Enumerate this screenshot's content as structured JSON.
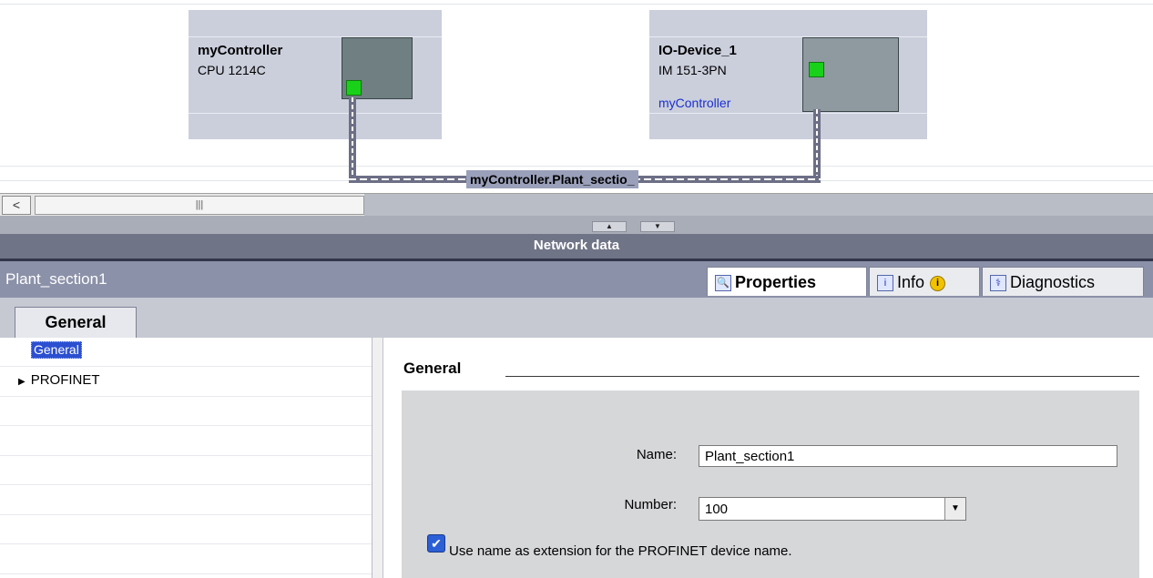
{
  "canvas": {
    "devices": [
      {
        "name": "myController",
        "type": "CPU 1214C",
        "assigned_to": ""
      },
      {
        "name": "IO-Device_1",
        "type": "IM 151-3PN",
        "assigned_to": "myController"
      }
    ],
    "subnet_label": "myController.Plant_sectio_"
  },
  "scrollbar": {
    "left_arrow": "<",
    "thumb_grip": "|||"
  },
  "splitter": {
    "up": "▲",
    "down": "▼"
  },
  "network_data_bar": {
    "title": "Network data"
  },
  "inspector": {
    "selected_object": "Plant_section1",
    "tabs": [
      {
        "label": "Properties",
        "icon": "properties-icon"
      },
      {
        "label": "Info",
        "icon": "info-icon"
      },
      {
        "label": "Diagnostics",
        "icon": "diagnostics-icon"
      }
    ],
    "info_badge": "i"
  },
  "subtab": {
    "label": "General"
  },
  "tree": {
    "items": [
      {
        "label": "General",
        "selected": true
      },
      {
        "label": "PROFINET",
        "expand_arrow": "▶"
      }
    ]
  },
  "general_section": {
    "heading": "General",
    "name_label": "Name:",
    "name_value": "Plant_section1",
    "number_label": "Number:",
    "number_value": "100",
    "dropdown_arrow": "▼",
    "checkbox_mark": "✔",
    "checkbox_checked": true,
    "checkbox_label": "Use name as extension for the PROFINET device name."
  }
}
